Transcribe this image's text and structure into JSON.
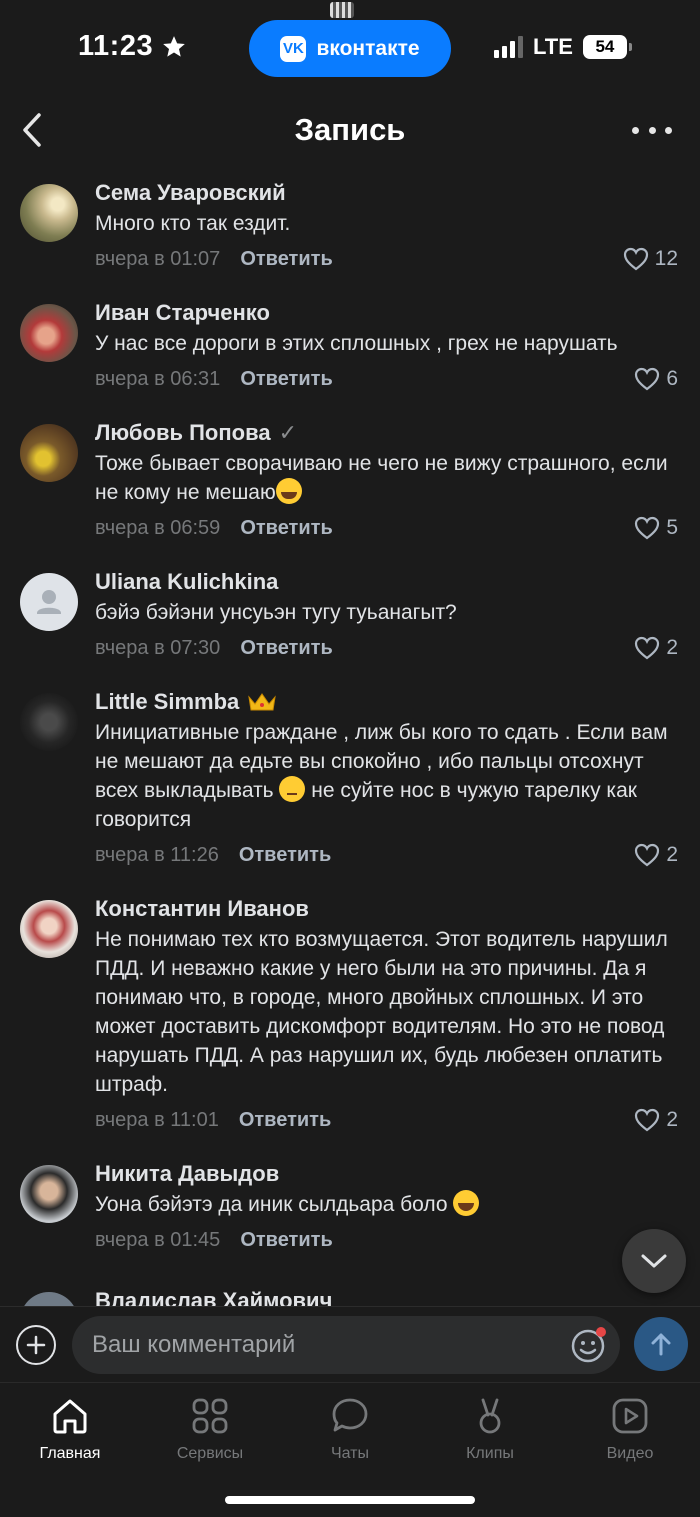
{
  "status": {
    "time": "11:23",
    "network": "LTE",
    "battery": "54",
    "app_pill": "вконтакте",
    "vk_logo": "VK"
  },
  "header": {
    "title": "Запись"
  },
  "comments": [
    {
      "author": "Сема Уваровский",
      "text": "Много кто так ездит.",
      "time": "вчера в 01:07",
      "reply": "Ответить",
      "likes": "12"
    },
    {
      "author": "Иван Старченко",
      "text": "У нас все дороги в этих сплошных , грех не нарушать",
      "time": "вчера в 06:31",
      "reply": "Ответить",
      "likes": "6"
    },
    {
      "author": "Любовь Попова",
      "text": "Тоже бывает сворачиваю не чего не вижу страшного, если не кому не мешаю",
      "time": "вчера в 06:59",
      "reply": "Ответить",
      "likes": "5"
    },
    {
      "author": "Uliana Kulichkina",
      "text": "бэйэ бэйэни унсуьэн тугу туьанагыт?",
      "time": "вчера в 07:30",
      "reply": "Ответить",
      "likes": "2"
    },
    {
      "author": "Little Simmba",
      "text_a": "Инициативные граждане , лиж бы кого то сдать . Если вам не мешают да едьте вы спокойно , ибо пальцы отсохнут всех выкладывать",
      "text_b": " не суйте нос в чужую тарелку как говорится",
      "time": "вчера в 11:26",
      "reply": "Ответить",
      "likes": "2"
    },
    {
      "author": "Константин Иванов",
      "text": "Не понимаю тех кто возмущается. Этот водитель нарушил ПДД. И неважно какие у него были на это причины. Да я понимаю что, в городе, много двойных сплошных. И это может доставить дискомфорт водителям. Но это не повод нарушать ПДД. А раз нарушил их, будь любезен оплатить штраф.",
      "time": "вчера в 11:01",
      "reply": "Ответить",
      "likes": "2"
    },
    {
      "author": "Никита Давыдов",
      "text": "Уона бэйэтэ да иник сылдьара боло",
      "time": "вчера в 01:45",
      "reply": "Ответить",
      "likes": ""
    },
    {
      "author": "Владислав Хаймович"
    }
  ],
  "composer": {
    "placeholder": "Ваш комментарий"
  },
  "tabs": [
    {
      "label": "Главная",
      "icon": "home-icon"
    },
    {
      "label": "Сервисы",
      "icon": "services-icon"
    },
    {
      "label": "Чаты",
      "icon": "chat-icon"
    },
    {
      "label": "Клипы",
      "icon": "clips-icon"
    },
    {
      "label": "Видео",
      "icon": "video-icon"
    }
  ],
  "colors": {
    "accent": "#0a7cff",
    "background": "#1b1b1b",
    "send": "#2a5885"
  }
}
